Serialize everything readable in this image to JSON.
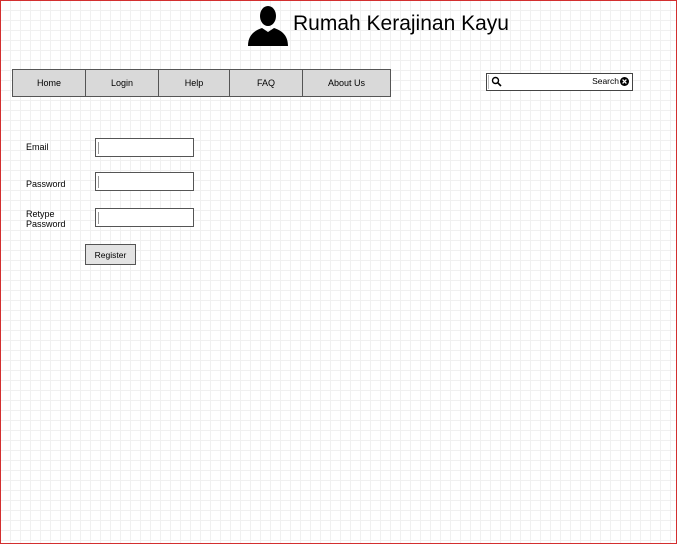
{
  "header": {
    "title": "Rumah Kerajinan Kayu",
    "logo_icon": "user-silhouette-icon"
  },
  "nav": {
    "items": [
      {
        "label": "Home"
      },
      {
        "label": "Login"
      },
      {
        "label": "Help"
      },
      {
        "label": "FAQ"
      },
      {
        "label": "About Us"
      }
    ]
  },
  "search": {
    "label": "Search",
    "value": "",
    "search_icon": "magnifier-icon",
    "clear_icon": "close-circle-icon"
  },
  "form": {
    "email_label": "Email",
    "email_value": "",
    "password_label": "Password",
    "password_value": "",
    "retype_label_line1": "Retype",
    "retype_label_line2": "Password",
    "retype_value": "",
    "register_label": "Register"
  },
  "colors": {
    "frame_border": "#d32f2f",
    "nav_background": "#d9d9d9"
  }
}
